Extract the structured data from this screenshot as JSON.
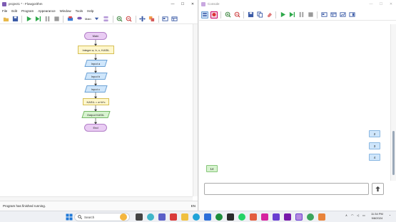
{
  "left_window": {
    "title": "project1 * - Flowgorithm",
    "menu": [
      "File",
      "Edit",
      "Program",
      "Appearance",
      "Window",
      "Tools",
      "Help"
    ],
    "toolbar_main_label": "Main",
    "status": "Program has finished running.",
    "status_right": "EN"
  },
  "flowchart": {
    "start": "Main",
    "declare": "Integer a, b, c, KASIL",
    "input_a": "Input a",
    "input_b": "Input b",
    "input_c": "Input c",
    "assign": "KASIL = a+b*c",
    "output": "Output KASIL",
    "end": "End"
  },
  "right_window": {
    "title": "Console",
    "inputs": [
      "2",
      "3",
      "4"
    ],
    "output": "14",
    "input_placeholder": ""
  },
  "taskbar": {
    "search_placeholder": "Search",
    "time": "11:34 PM",
    "date": "9/8/2024"
  },
  "colors": {
    "terminal": "#e9ccf3",
    "declare": "#fff7cc",
    "io": "#cfe6fb",
    "output": "#d7f3cf",
    "run_green": "#2ea84a"
  }
}
